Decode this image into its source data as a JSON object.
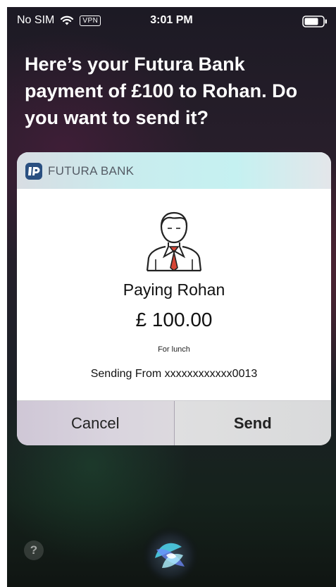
{
  "status_bar": {
    "carrier": "No SIM",
    "vpn": "VPN",
    "time": "3:01 PM"
  },
  "siri": {
    "prompt": "Here’s your Futura Bank payment of £100 to Rohan. Do you want to send it?",
    "help_label": "?"
  },
  "card": {
    "bank_name": "FUTURA BANK",
    "payee": "Paying Rohan",
    "amount": "£ 100.00",
    "memo": "For lunch",
    "sending_from": "Sending From xxxxxxxxxxxx0013",
    "cancel_label": "Cancel",
    "send_label": "Send"
  },
  "icons": {
    "wifi": "wifi-icon",
    "battery": "battery-icon",
    "bank_logo": "futura-bank-logo",
    "person": "person-icon",
    "siri": "siri-orb-icon"
  },
  "colors": {
    "header_tint": "#c5f1f1",
    "logo_blue": "#2a4f80",
    "tie_red": "#d64535"
  }
}
